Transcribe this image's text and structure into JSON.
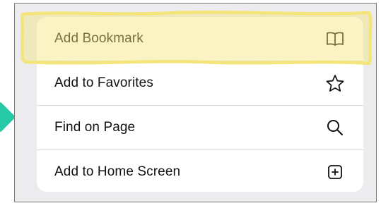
{
  "menu": {
    "items": [
      {
        "label": "Add Bookmark",
        "icon": "book-icon"
      },
      {
        "label": "Add to Favorites",
        "icon": "star-icon"
      },
      {
        "label": "Find on Page",
        "icon": "search-icon"
      },
      {
        "label": "Add to Home Screen",
        "icon": "add-square-icon"
      }
    ]
  },
  "colors": {
    "highlight": "#f3e57a",
    "pointer": "#25c9a5",
    "menu_background": "#ffffff",
    "frame_background": "#ececee"
  }
}
